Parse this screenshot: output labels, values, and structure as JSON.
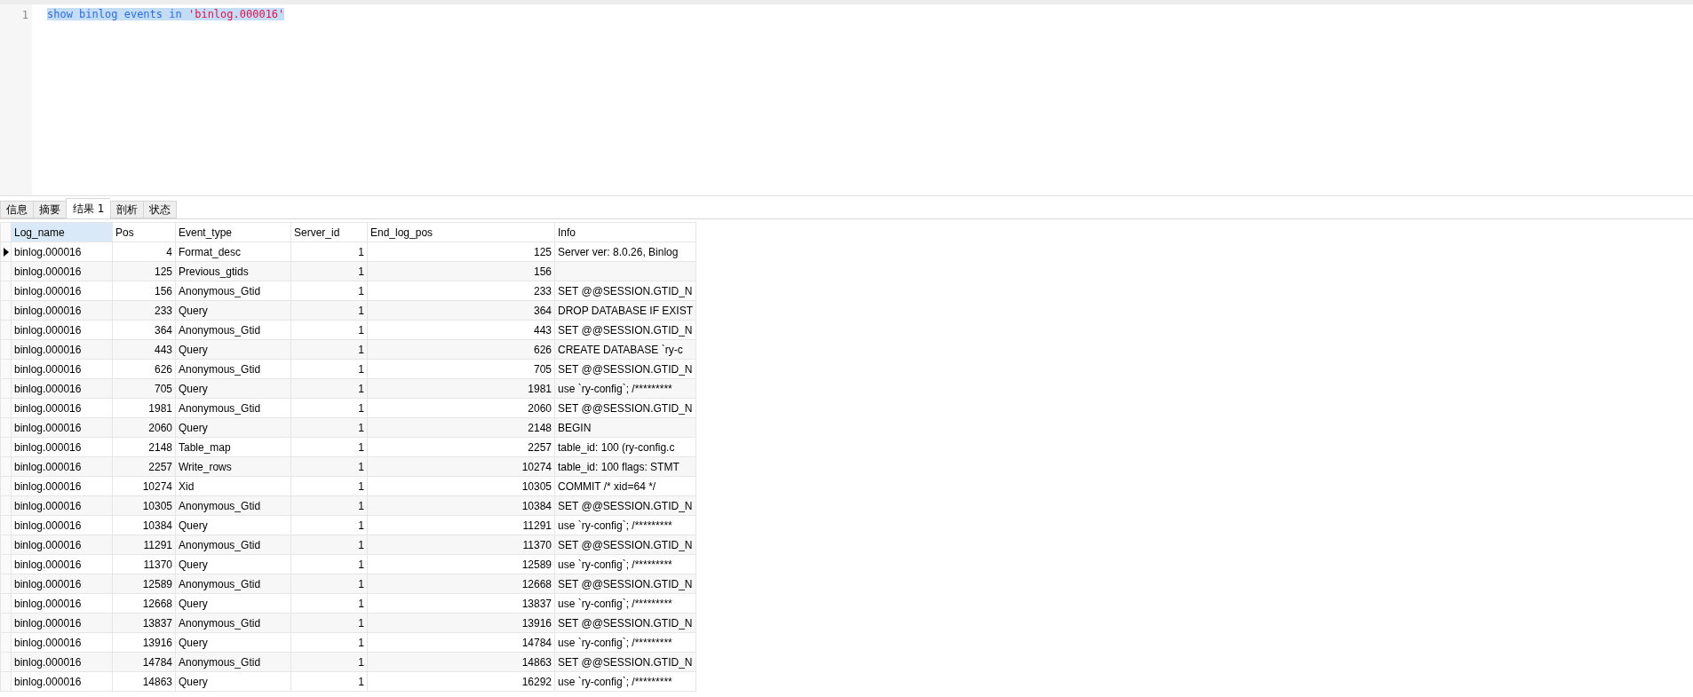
{
  "editor": {
    "lines": [
      {
        "number": "1",
        "parts": [
          {
            "kind": "keyword",
            "text": "show binlog events in "
          },
          {
            "kind": "string",
            "text": "'binlog.000016'"
          }
        ],
        "selected": true
      }
    ]
  },
  "result_tabs": [
    {
      "label": "信息",
      "selected": false
    },
    {
      "label": "摘要",
      "selected": false
    },
    {
      "label": "结果 1",
      "selected": true
    },
    {
      "label": "剖析",
      "selected": false
    },
    {
      "label": "状态",
      "selected": false
    }
  ],
  "table": {
    "columns": [
      {
        "label": "Log_name",
        "selected": true
      },
      {
        "label": "Pos",
        "selected": false
      },
      {
        "label": "Event_type",
        "selected": false
      },
      {
        "label": "Server_id",
        "selected": false
      },
      {
        "label": "End_log_pos",
        "selected": false
      },
      {
        "label": "Info",
        "selected": false
      }
    ],
    "rows": [
      {
        "current": true,
        "cells": [
          "binlog.000016",
          "4",
          "Format_desc",
          "1",
          "125",
          "Server ver: 8.0.26, Binlog"
        ]
      },
      {
        "current": false,
        "cells": [
          "binlog.000016",
          "125",
          "Previous_gtids",
          "1",
          "156"
        ]
      },
      {
        "current": false,
        "cells": [
          "binlog.000016",
          "156",
          "Anonymous_Gtid",
          "1",
          "233",
          "SET @@SESSION.GTID_N"
        ]
      },
      {
        "current": false,
        "cells": [
          "binlog.000016",
          "233",
          "Query",
          "1",
          "364",
          "DROP DATABASE IF EXIST"
        ]
      },
      {
        "current": false,
        "cells": [
          "binlog.000016",
          "364",
          "Anonymous_Gtid",
          "1",
          "443",
          "SET @@SESSION.GTID_N"
        ]
      },
      {
        "current": false,
        "cells": [
          "binlog.000016",
          "443",
          "Query",
          "1",
          "626",
          "CREATE DATABASE  `ry-c"
        ]
      },
      {
        "current": false,
        "cells": [
          "binlog.000016",
          "626",
          "Anonymous_Gtid",
          "1",
          "705",
          "SET @@SESSION.GTID_N"
        ]
      },
      {
        "current": false,
        "cells": [
          "binlog.000016",
          "705",
          "Query",
          "1",
          "1981",
          "use `ry-config`; /*********"
        ]
      },
      {
        "current": false,
        "cells": [
          "binlog.000016",
          "1981",
          "Anonymous_Gtid",
          "1",
          "2060",
          "SET @@SESSION.GTID_N"
        ]
      },
      {
        "current": false,
        "cells": [
          "binlog.000016",
          "2060",
          "Query",
          "1",
          "2148",
          "BEGIN"
        ]
      },
      {
        "current": false,
        "cells": [
          "binlog.000016",
          "2148",
          "Table_map",
          "1",
          "2257",
          "table_id: 100 (ry-config.c"
        ]
      },
      {
        "current": false,
        "cells": [
          "binlog.000016",
          "2257",
          "Write_rows",
          "1",
          "10274",
          "table_id: 100 flags: STMT"
        ]
      },
      {
        "current": false,
        "cells": [
          "binlog.000016",
          "10274",
          "Xid",
          "1",
          "10305",
          "COMMIT /* xid=64 */"
        ]
      },
      {
        "current": false,
        "cells": [
          "binlog.000016",
          "10305",
          "Anonymous_Gtid",
          "1",
          "10384",
          "SET @@SESSION.GTID_N"
        ]
      },
      {
        "current": false,
        "cells": [
          "binlog.000016",
          "10384",
          "Query",
          "1",
          "11291",
          "use `ry-config`; /*********"
        ]
      },
      {
        "current": false,
        "cells": [
          "binlog.000016",
          "11291",
          "Anonymous_Gtid",
          "1",
          "11370",
          "SET @@SESSION.GTID_N"
        ]
      },
      {
        "current": false,
        "cells": [
          "binlog.000016",
          "11370",
          "Query",
          "1",
          "12589",
          "use `ry-config`; /*********"
        ]
      },
      {
        "current": false,
        "cells": [
          "binlog.000016",
          "12589",
          "Anonymous_Gtid",
          "1",
          "12668",
          "SET @@SESSION.GTID_N"
        ]
      },
      {
        "current": false,
        "cells": [
          "binlog.000016",
          "12668",
          "Query",
          "1",
          "13837",
          "use `ry-config`; /*********"
        ]
      },
      {
        "current": false,
        "cells": [
          "binlog.000016",
          "13837",
          "Anonymous_Gtid",
          "1",
          "13916",
          "SET @@SESSION.GTID_N"
        ]
      },
      {
        "current": false,
        "cells": [
          "binlog.000016",
          "13916",
          "Query",
          "1",
          "14784",
          "use `ry-config`; /*********"
        ]
      },
      {
        "current": false,
        "cells": [
          "binlog.000016",
          "14784",
          "Anonymous_Gtid",
          "1",
          "14863",
          "SET @@SESSION.GTID_N"
        ]
      },
      {
        "current": false,
        "cells": [
          "binlog.000016",
          "14863",
          "Query",
          "1",
          "16292",
          "use `ry-config`; /*********"
        ]
      }
    ]
  }
}
